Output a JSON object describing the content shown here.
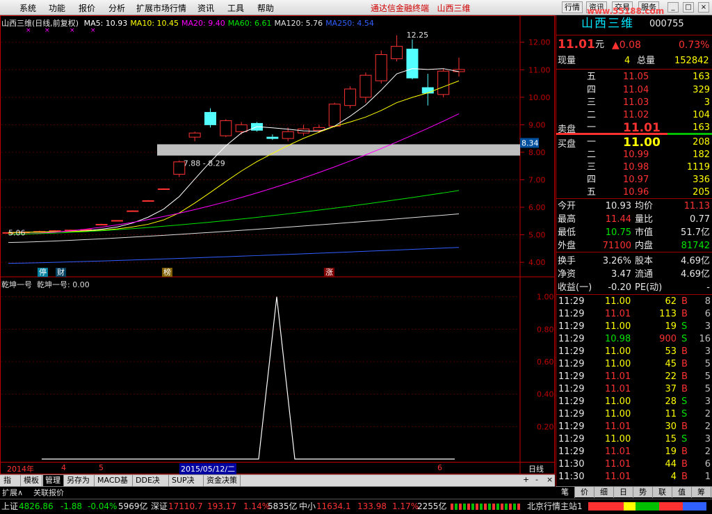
{
  "menu": {
    "items": [
      "系统",
      "功能",
      "报价",
      "分析",
      "扩展市场行情",
      "资讯",
      "工具",
      "帮助"
    ],
    "app_label": "通达信金融终端",
    "stock_label": "山西三维",
    "right_buttons": [
      "行情",
      "资讯",
      "交易",
      "服务"
    ],
    "watermark": "www.55188.com"
  },
  "chart_info": {
    "title": "山西三维(日线,前复权)",
    "ma": [
      {
        "label": "MA5: 10.93",
        "color": "#ffffff"
      },
      {
        "label": "MA10: 10.45",
        "color": "#ffff00"
      },
      {
        "label": "MA20: 9.40",
        "color": "#ff00ff"
      },
      {
        "label": "MA60: 6.61",
        "color": "#00e600"
      },
      {
        "label": "MA120: 5.76",
        "color": "#e0e0e0"
      },
      {
        "label": "MA250: 4.54",
        "color": "#3060ff"
      }
    ]
  },
  "price_axis": {
    "ticks": [
      "12.00",
      "11.00",
      "10.00",
      "9.00",
      "8.00",
      "7.00",
      "6.00",
      "5.00",
      "4.00"
    ],
    "current_tag": "8.34"
  },
  "annotations": {
    "high": "12.25",
    "band": "7.88 - 8.29",
    "low": "5.06"
  },
  "badges": [
    "停",
    "财",
    "榜",
    "涨"
  ],
  "indicator": {
    "name": "乾坤一号",
    "value_label": "乾坤一号: 0.00",
    "ticks": [
      "1.00",
      "0.80",
      "0.60",
      "0.40",
      "0.20"
    ]
  },
  "date_axis": {
    "labels": [
      "2014年",
      "4",
      "5",
      "2015/05/12/二",
      "6"
    ],
    "period": "日线"
  },
  "tabs": [
    "指标",
    "模板",
    "管理",
    "另存为",
    "MACD基本",
    "DDE决策",
    "SUP决策",
    "资金决策"
  ],
  "tab_controls": [
    "+",
    "-",
    "×"
  ],
  "ext_bar": {
    "expand": "扩展∧",
    "related": "关联报价"
  },
  "quote": {
    "name": "山西三维",
    "code": "000755",
    "price": "11.01",
    "unit": "元",
    "change": "▲0.08",
    "pct": "0.73%",
    "volume_label": "现量",
    "volume": "4",
    "total_label": "总量",
    "total": "152842",
    "asks": [
      {
        "lvl": "五",
        "price": "11.05",
        "vol": "163"
      },
      {
        "lvl": "四",
        "price": "11.04",
        "vol": "329"
      },
      {
        "lvl": "三",
        "price": "11.03",
        "vol": "3"
      },
      {
        "lvl": "二",
        "price": "11.02",
        "vol": "104"
      },
      {
        "lvl": "一",
        "price": "11.01",
        "vol": "163"
      }
    ],
    "ask_label": "卖盘",
    "bid_label": "买盘",
    "bids": [
      {
        "lvl": "一",
        "price": "11.00",
        "vol": "208"
      },
      {
        "lvl": "二",
        "price": "10.99",
        "vol": "182"
      },
      {
        "lvl": "三",
        "price": "10.98",
        "vol": "1119"
      },
      {
        "lvl": "四",
        "price": "10.97",
        "vol": "336"
      },
      {
        "lvl": "五",
        "price": "10.96",
        "vol": "205"
      }
    ],
    "stats": [
      {
        "l1": "今开",
        "v1": "10.93",
        "c1": "white",
        "l2": "均价",
        "v2": "11.13",
        "c2": "red"
      },
      {
        "l1": "最高",
        "v1": "11.44",
        "c1": "red",
        "l2": "量比",
        "v2": "0.77",
        "c2": "white"
      },
      {
        "l1": "最低",
        "v1": "10.75",
        "c1": "green",
        "l2": "市值",
        "v2": "51.7亿",
        "c2": "white"
      },
      {
        "l1": "外盘",
        "v1": "71100",
        "c1": "red",
        "l2": "内盘",
        "v2": "81742",
        "c2": "green"
      },
      {
        "l1": "换手",
        "v1": "3.26%",
        "c1": "white",
        "l2": "股本",
        "v2": "4.69亿",
        "c2": "white"
      },
      {
        "l1": "净资",
        "v1": "3.47",
        "c1": "white",
        "l2": "流通",
        "v2": "4.69亿",
        "c2": "white"
      },
      {
        "l1": "收益(一)",
        "v1": "-0.20",
        "c1": "white",
        "l2": "PE(动)",
        "v2": "-",
        "c2": "white"
      }
    ]
  },
  "ticks": [
    {
      "t": "11:29",
      "p": "11.00",
      "pc": "yellow",
      "v": "62",
      "bs": "B",
      "n": "8"
    },
    {
      "t": "11:29",
      "p": "11.01",
      "pc": "red",
      "v": "113",
      "bs": "B",
      "n": "6"
    },
    {
      "t": "11:29",
      "p": "11.00",
      "pc": "yellow",
      "v": "19",
      "bs": "S",
      "n": "3"
    },
    {
      "t": "11:29",
      "p": "10.98",
      "pc": "green",
      "v": "900",
      "bs": "S",
      "n": "16"
    },
    {
      "t": "11:29",
      "p": "11.00",
      "pc": "yellow",
      "v": "53",
      "bs": "B",
      "n": "3"
    },
    {
      "t": "11:29",
      "p": "11.00",
      "pc": "yellow",
      "v": "45",
      "bs": "B",
      "n": "5"
    },
    {
      "t": "11:29",
      "p": "11.01",
      "pc": "red",
      "v": "22",
      "bs": "B",
      "n": "5"
    },
    {
      "t": "11:29",
      "p": "11.01",
      "pc": "red",
      "v": "37",
      "bs": "B",
      "n": "5"
    },
    {
      "t": "11:29",
      "p": "11.00",
      "pc": "yellow",
      "v": "28",
      "bs": "S",
      "n": "3"
    },
    {
      "t": "11:29",
      "p": "11.00",
      "pc": "yellow",
      "v": "11",
      "bs": "S",
      "n": "2"
    },
    {
      "t": "11:29",
      "p": "11.01",
      "pc": "red",
      "v": "30",
      "bs": "B",
      "n": "2"
    },
    {
      "t": "11:29",
      "p": "11.00",
      "pc": "yellow",
      "v": "15",
      "bs": "S",
      "n": "3"
    },
    {
      "t": "11:29",
      "p": "11.01",
      "pc": "red",
      "v": "19",
      "bs": "B",
      "n": "2"
    },
    {
      "t": "11:30",
      "p": "11.01",
      "pc": "red",
      "v": "44",
      "bs": "B",
      "n": "6"
    },
    {
      "t": "11:30",
      "p": "11.01",
      "pc": "red",
      "v": "4",
      "bs": "B",
      "n": "1"
    }
  ],
  "panel_tabs": [
    "笔",
    "价",
    "细",
    "日",
    "势",
    "联",
    "值",
    "筹"
  ],
  "status": {
    "sh_label": "上证",
    "sh_value": "4826.86",
    "sh_change": "-1.88",
    "sh_pct": "-0.04%",
    "sh_amt": "5969亿",
    "sz_label": "深证",
    "sz_value": "17110.7",
    "sz_change": "193.17",
    "sz_pct": "1.14%",
    "sz_amt": "5835亿",
    "zx_label": "中小",
    "zx_value": "11634.1",
    "zx_change": "133.98",
    "zx_pct": "1.17%",
    "zx_amt": "2255亿",
    "server": "北京行情主站1"
  },
  "chart_data": [
    {
      "type": "candlestick",
      "ylim": [
        3.8,
        12.6
      ],
      "yticks": [
        4,
        5,
        6,
        7,
        8,
        9,
        10,
        11,
        12
      ],
      "ohlc": [
        [
          5.06,
          5.1,
          5.04,
          5.08
        ],
        [
          5.08,
          5.12,
          5.06,
          5.1
        ],
        [
          5.1,
          5.15,
          5.08,
          5.12
        ],
        [
          5.12,
          5.17,
          5.1,
          5.15
        ],
        [
          5.15,
          5.19,
          5.13,
          5.17
        ],
        [
          5.17,
          5.21,
          5.16,
          5.19
        ],
        [
          5.37,
          5.4,
          5.36,
          5.38
        ],
        [
          5.5,
          5.53,
          5.49,
          5.52
        ],
        [
          5.86,
          5.89,
          5.85,
          5.87
        ],
        [
          6.23,
          6.26,
          6.22,
          6.24
        ],
        [
          6.66,
          6.69,
          6.65,
          6.67
        ],
        [
          7.2,
          7.7,
          7.1,
          7.65
        ],
        [
          8.55,
          8.75,
          8.4,
          8.7
        ],
        [
          9.45,
          9.6,
          8.9,
          9.0
        ],
        [
          8.6,
          9.2,
          8.55,
          9.15
        ],
        [
          8.75,
          9.1,
          8.65,
          9.0
        ],
        [
          9.05,
          9.1,
          8.75,
          8.8
        ],
        [
          8.55,
          8.65,
          8.45,
          8.5
        ],
        [
          8.5,
          8.9,
          8.4,
          8.75
        ],
        [
          8.7,
          9.0,
          8.6,
          8.85
        ],
        [
          8.8,
          9.0,
          8.7,
          8.9
        ],
        [
          8.95,
          9.8,
          8.9,
          9.75
        ],
        [
          9.7,
          10.4,
          9.6,
          10.3
        ],
        [
          10.0,
          10.9,
          9.8,
          10.8
        ],
        [
          10.6,
          11.7,
          10.5,
          11.55
        ],
        [
          11.4,
          12.25,
          11.3,
          11.85
        ],
        [
          11.75,
          12.1,
          10.65,
          10.7
        ],
        [
          10.35,
          10.85,
          9.7,
          10.15
        ],
        [
          10.1,
          11.05,
          10.0,
          10.95
        ],
        [
          10.93,
          11.44,
          10.75,
          11.01
        ]
      ],
      "ma5_end": 10.93,
      "ma10_end": 10.45,
      "ma20_end": 9.4,
      "ma60_end": 6.61,
      "ma120_end": 5.76,
      "ma250_end": 4.54,
      "band": [
        7.88,
        8.29
      ],
      "high_label": 12.25,
      "low_label": 5.06
    },
    {
      "type": "line",
      "name": "乾坤一号",
      "ylim": [
        0,
        1.05
      ],
      "yticks": [
        0.2,
        0.4,
        0.6,
        0.8,
        1.0
      ],
      "x": [
        0,
        1,
        2,
        3,
        4,
        5,
        6,
        7,
        8,
        9,
        10
      ],
      "values": [
        0,
        0,
        0,
        0,
        0,
        1,
        0,
        0,
        0,
        0,
        0
      ]
    }
  ]
}
